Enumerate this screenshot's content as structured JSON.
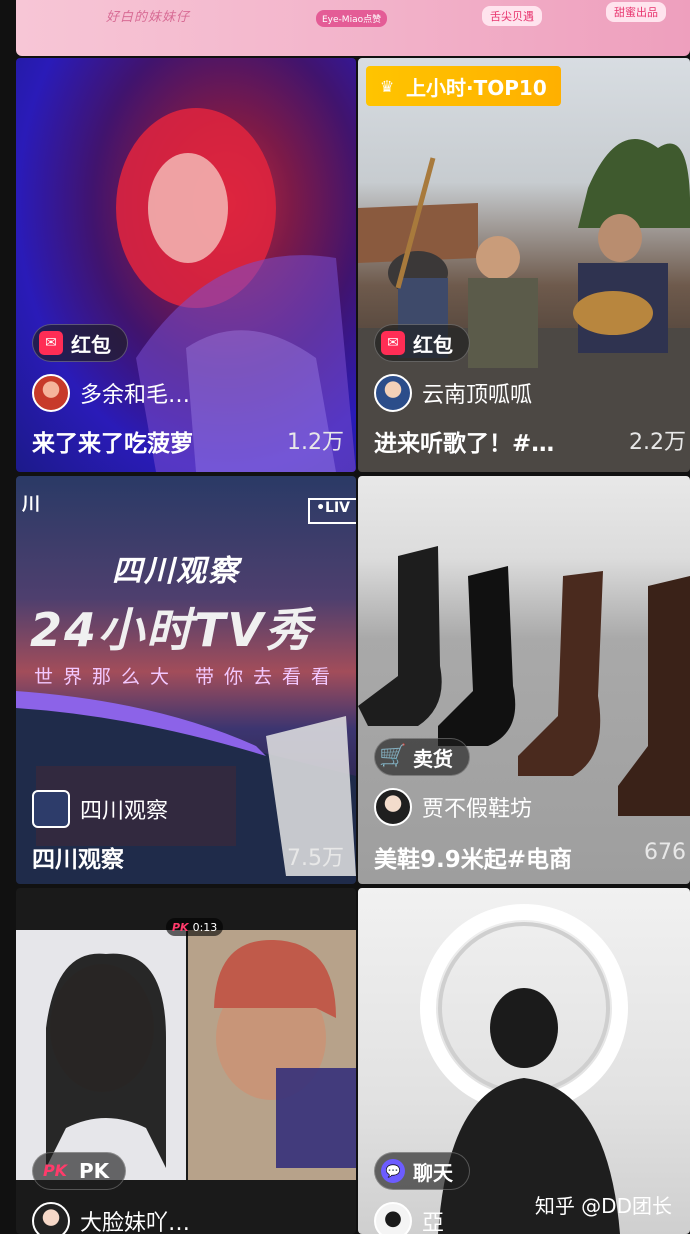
{
  "banner": {
    "script_text": "好白的妹妹仔",
    "tag_left": "Eye-Miao点赞",
    "tag_mid": "舌尖贝遇",
    "tag_right": "甜蜜出品"
  },
  "cards": [
    {
      "badge": "红包",
      "badge_icon": "red-envelope-icon",
      "streamer": "多余和毛…",
      "title": "来了来了吃菠萝",
      "count": "1.2万"
    },
    {
      "rank_tag": "上小时·TOP10",
      "badge": "红包",
      "badge_icon": "red-envelope-icon",
      "streamer": "云南顶呱呱",
      "title": "进来听歌了！#…",
      "count": "2.2万"
    },
    {
      "poster_line1": "四川观察",
      "poster_line2": "24小时TV秀",
      "poster_line3": "世界那么大 带你去看看",
      "live_tag": "•LIV",
      "corner_text": "川",
      "streamer": "四川观察",
      "title": "四川观察",
      "count": "7.5万"
    },
    {
      "badge": "卖货",
      "badge_icon": "shopping-cart-icon",
      "streamer": "贾不假鞋坊",
      "title": "美鞋9.9米起#电商",
      "count": "676"
    },
    {
      "pk_bar": "0:13",
      "badge": "PK",
      "badge_icon": "pk-icon",
      "streamer": "大脸妹吖…"
    },
    {
      "badge": "聊天",
      "badge_icon": "chat-icon",
      "streamer": "亞"
    }
  ],
  "watermark": "知乎 @DD团长"
}
